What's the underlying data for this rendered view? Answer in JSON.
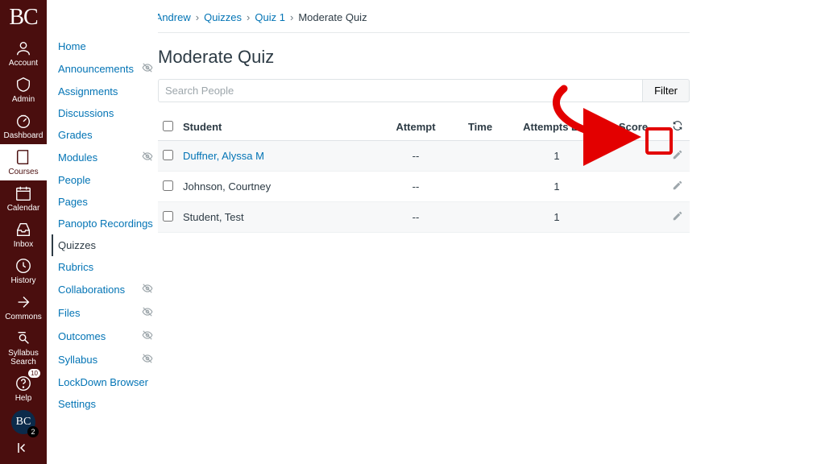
{
  "brand": "BC",
  "globalNav": {
    "items": [
      {
        "key": "account",
        "label": "Account"
      },
      {
        "key": "admin",
        "label": "Admin"
      },
      {
        "key": "dashboard",
        "label": "Dashboard"
      },
      {
        "key": "courses",
        "label": "Courses"
      },
      {
        "key": "calendar",
        "label": "Calendar"
      },
      {
        "key": "inbox",
        "label": "Inbox"
      },
      {
        "key": "history",
        "label": "History"
      },
      {
        "key": "commons",
        "label": "Commons"
      },
      {
        "key": "syllabus",
        "label": "Syllabus\nSearch"
      },
      {
        "key": "help",
        "label": "Help",
        "badge": "10"
      }
    ],
    "activeKey": "courses"
  },
  "breadcrumbs": [
    {
      "label": "Practice Site for Andrew",
      "link": true
    },
    {
      "label": "Quizzes",
      "link": true
    },
    {
      "label": "Quiz 1",
      "link": true
    },
    {
      "label": "Moderate Quiz",
      "link": false
    }
  ],
  "courseNav": {
    "activeKey": "quizzes",
    "items": [
      {
        "key": "home",
        "label": "Home"
      },
      {
        "key": "announcements",
        "label": "Announcements",
        "hidden": true
      },
      {
        "key": "assignments",
        "label": "Assignments"
      },
      {
        "key": "discussions",
        "label": "Discussions"
      },
      {
        "key": "grades",
        "label": "Grades"
      },
      {
        "key": "modules",
        "label": "Modules",
        "hidden": true
      },
      {
        "key": "people",
        "label": "People"
      },
      {
        "key": "pages",
        "label": "Pages"
      },
      {
        "key": "panopto",
        "label": "Panopto Recordings"
      },
      {
        "key": "quizzes",
        "label": "Quizzes"
      },
      {
        "key": "rubrics",
        "label": "Rubrics"
      },
      {
        "key": "collaborations",
        "label": "Collaborations",
        "hidden": true
      },
      {
        "key": "files",
        "label": "Files",
        "hidden": true
      },
      {
        "key": "outcomes",
        "label": "Outcomes",
        "hidden": true
      },
      {
        "key": "syllabus",
        "label": "Syllabus",
        "hidden": true
      },
      {
        "key": "lockdown",
        "label": "LockDown Browser"
      },
      {
        "key": "settings",
        "label": "Settings"
      }
    ]
  },
  "page": {
    "title": "Moderate Quiz",
    "search_placeholder": "Search People",
    "filter_label": "Filter",
    "columns": {
      "student": "Student",
      "attempt": "Attempt",
      "time": "Time",
      "attempts_left": "Attempts Left",
      "score": "Score"
    },
    "rows": [
      {
        "name": "Duffner, Alyssa M",
        "link": true,
        "attempt": "--",
        "time": "",
        "attempts_left": "1",
        "score": ""
      },
      {
        "name": "Johnson, Courtney",
        "link": false,
        "attempt": "--",
        "time": "",
        "attempts_left": "1",
        "score": ""
      },
      {
        "name": "Student, Test",
        "link": false,
        "attempt": "--",
        "time": "",
        "attempts_left": "1",
        "score": ""
      }
    ]
  },
  "annotation": {
    "arrow_color": "#e30000"
  }
}
